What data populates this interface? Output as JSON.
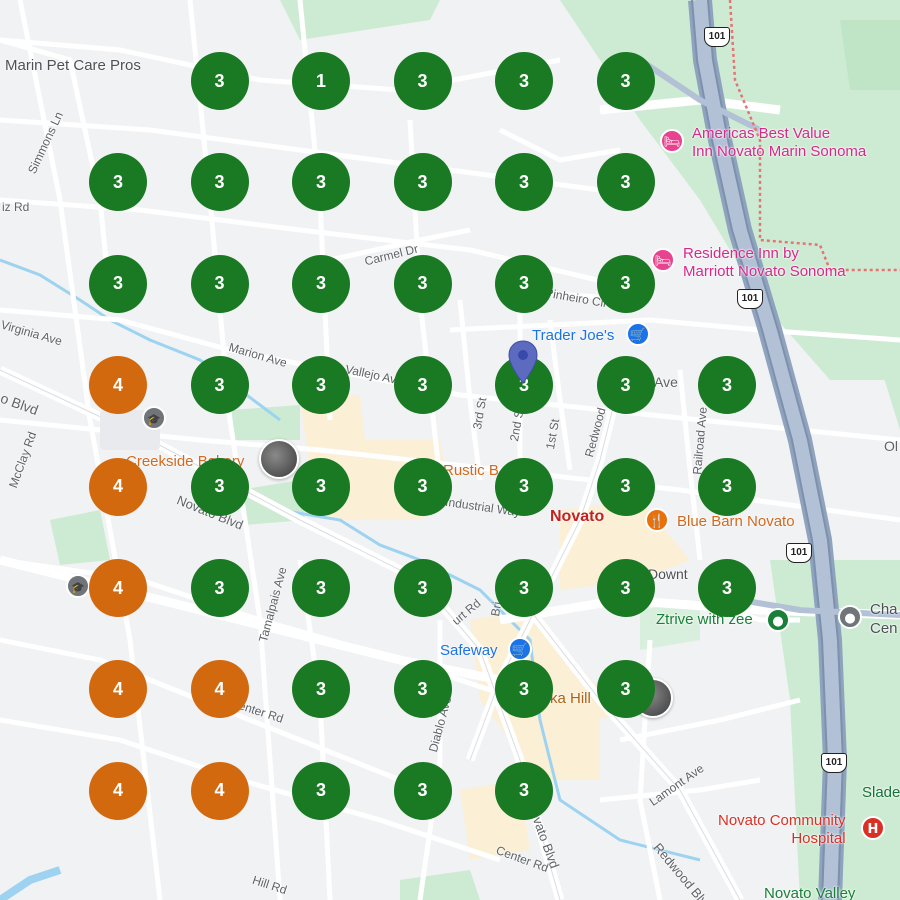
{
  "colors": {
    "rank_green": "#1a7a23",
    "rank_orange": "#d2690f",
    "map_bg": "#f1f2f4",
    "highway": "#8fa3bf",
    "park": "#cdebd3",
    "water": "#9dd3f0",
    "commercial": "#fbefd6",
    "hotel_pink": "#d6298a",
    "store_blue": "#1a73e8"
  },
  "grid_ranks": [
    [
      null,
      3,
      1,
      3,
      3,
      3,
      null
    ],
    [
      3,
      3,
      3,
      3,
      3,
      3,
      null
    ],
    [
      3,
      3,
      3,
      3,
      3,
      3,
      null
    ],
    [
      4,
      3,
      3,
      3,
      3,
      3,
      3
    ],
    [
      4,
      3,
      3,
      3,
      3,
      3,
      3
    ],
    [
      4,
      3,
      3,
      3,
      3,
      3,
      3
    ],
    [
      4,
      4,
      3,
      3,
      3,
      3,
      null
    ],
    [
      4,
      4,
      3,
      3,
      3,
      null,
      null
    ]
  ],
  "labels": {
    "marin_pet": "Marin Pet Care Pros",
    "simmons": "Simmons Ln",
    "iz_rd": "iz Rd",
    "carmel": "Carmel Dr",
    "pinheiro": "Pinheiro Cir",
    "virginia": "Virginia Ave",
    "marion": "Marion Ave",
    "vallejo": "Vallejo Ave",
    "o_blvd": "o Blvd",
    "mcclay": "McClay Rd",
    "novato_blvd": "Novato Blvd",
    "creekside": "Creekside Bakery",
    "rustic": "Rustic B",
    "third_st": "3rd St",
    "second_st": "2nd St",
    "first_st": "1st St",
    "redwood": "Redwood",
    "railroad": "Railroad Ave",
    "industrial": "Industrial Way",
    "novato": "Novato",
    "grant_ave": "Ave",
    "americas_best": "Americas Best Value\nInn Novato Marin Sonoma",
    "residence_inn": "Residence Inn by\nMarriott Novato Sonoma",
    "trader_joes": "Trader Joe's",
    "blue_barn": "Blue Barn Novato",
    "downt": "Downt",
    "ztrive": "Ztrive with zee",
    "cha": "Cha",
    "cen": "Cen",
    "safeway": "Safeway",
    "tamalpais": "Tamalpais Ave",
    "court_rd": "urt Rd",
    "bri": "Bri",
    "diablo": "Diablo Ave",
    "ka_hill": "ka Hill",
    "enter_rd": "enter Rd",
    "lamont": "Lamont Ave",
    "center_rd": "Center Rd",
    "hill_rd": "Hill Rd",
    "redwood_blvd": "Redwood Blv",
    "vato_blvd": "vato Blvd",
    "novato_community": "Novato Community\nHospital",
    "slade": "Slade",
    "novato_valley": "Novato Valley",
    "ol": "Ol"
  },
  "shields": [
    "101",
    "101",
    "101",
    "101"
  ],
  "icons": {
    "hotel": "bed-icon",
    "shopping": "shopping-cart-icon",
    "restaurant": "fork-knife-icon",
    "hospital": "hospital-h-icon",
    "school": "graduation-cap-icon",
    "location": "place-dot-icon",
    "pin": "location-pin-icon"
  }
}
